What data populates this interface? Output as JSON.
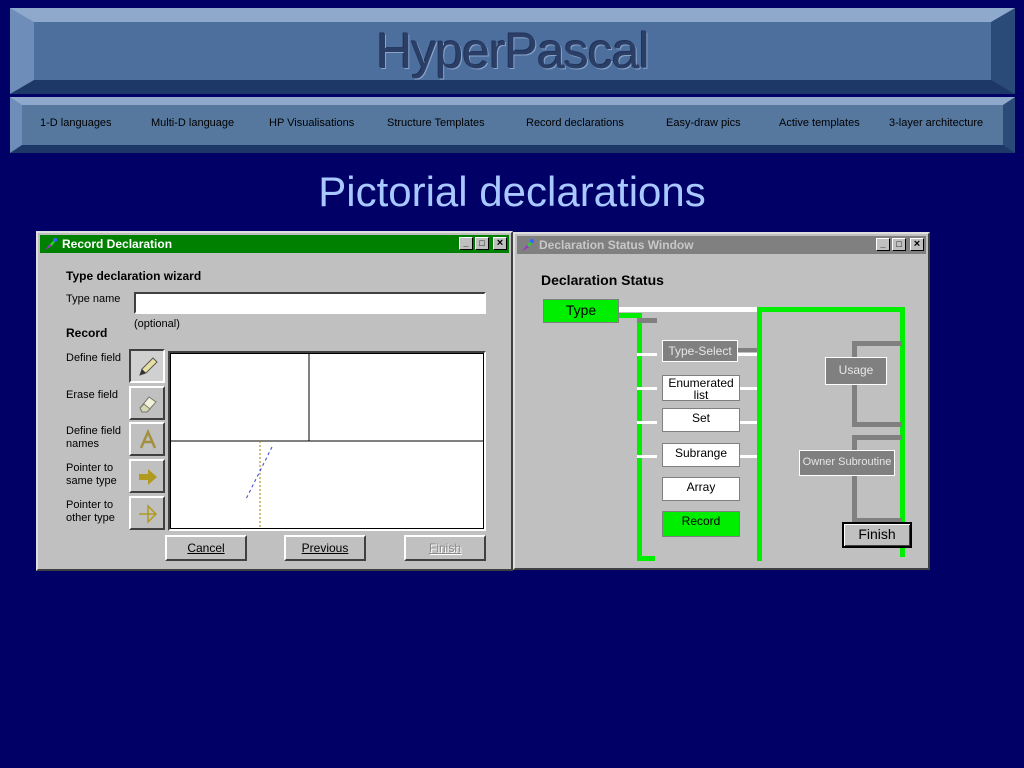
{
  "banner": {
    "title": "HyperPascal"
  },
  "nav": [
    "1-D languages",
    "Multi-D language",
    "HP Visualisations",
    "Structure Templates",
    "Record declarations",
    "Easy-draw pics",
    "Active templates",
    "3-layer architecture"
  ],
  "heading": "Pictorial declarations",
  "record_window": {
    "title": "Record Declaration",
    "title_color": "#008000",
    "wizard_heading": "Type declaration wizard",
    "type_name_label": "Type name",
    "type_name_value": "",
    "optional_note": "(optional)",
    "record_heading": "Record",
    "tools": [
      {
        "label": "Define field",
        "icon": "pencil-icon"
      },
      {
        "label": "Erase field",
        "icon": "eraser-icon"
      },
      {
        "label": "Define field names",
        "icon": "letter-a-icon"
      },
      {
        "label": "Pointer to same type",
        "icon": "arrow-filled-icon"
      },
      {
        "label": "Pointer to other type",
        "icon": "arrow-outline-icon"
      }
    ],
    "buttons": {
      "cancel": "Cancel",
      "previous": "Previous",
      "finish": "Finish"
    }
  },
  "status_window": {
    "title": "Declaration Status Window",
    "title_color": "#808080",
    "heading": "Declaration Status",
    "type_node": "Type",
    "nodes": {
      "type_select": "Type-Select",
      "enumerated": "Enumerated list",
      "set": "Set",
      "subrange": "Subrange",
      "array": "Array",
      "record": "Record",
      "usage": "Usage",
      "owner": "Owner Subroutine"
    },
    "finish": "Finish",
    "active_color": "#00ee00"
  },
  "window_controls": {
    "minimize": "_",
    "maximize": "□",
    "close": "×"
  }
}
